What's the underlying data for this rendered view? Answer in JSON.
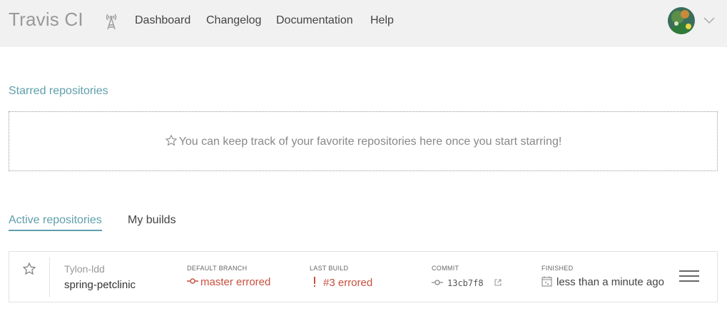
{
  "header": {
    "logo": "Travis CI",
    "nav": [
      "Dashboard",
      "Changelog",
      "Documentation",
      "Help"
    ]
  },
  "starred": {
    "title": "Starred repositories",
    "empty_message": "You can keep track of your favorite repositories here once you start starring!"
  },
  "tabs": {
    "active": "Active repositories",
    "builds": "My builds"
  },
  "repo": {
    "owner": "Tylon-ldd",
    "name": "spring-petclinic",
    "default_branch_label": "DEFAULT BRANCH",
    "default_branch_value": "master errored",
    "last_build_label": "LAST BUILD",
    "last_build_value": "#3 errored",
    "commit_label": "COMMIT",
    "commit_value": "13cb7f8",
    "finished_label": "FINISHED",
    "finished_value": "less than a minute ago"
  },
  "colors": {
    "accent": "#5e9fac",
    "error": "#c74f3d",
    "header_bg": "#f1f1f1"
  }
}
